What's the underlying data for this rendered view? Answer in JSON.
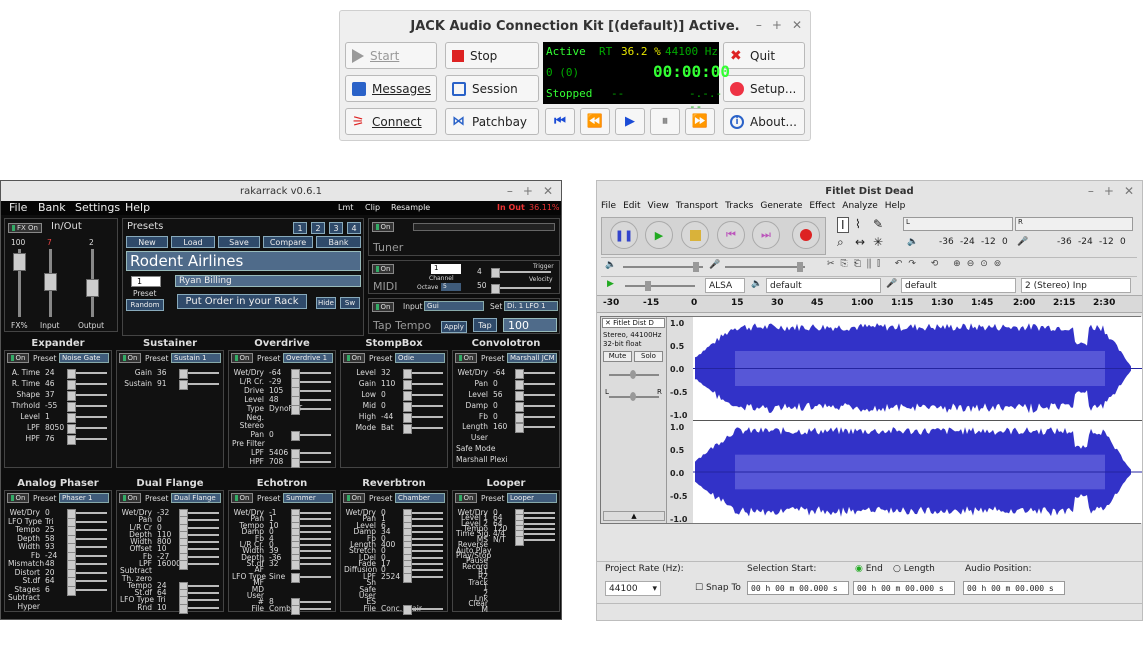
{
  "jack": {
    "title": "JACK Audio Connection Kit [(default)] Active.",
    "buttons": {
      "start": "Start",
      "stop": "Stop",
      "quit": "Quit",
      "messages": "Messages",
      "session": "Session",
      "setup": "Setup...",
      "connect": "Connect",
      "patchbay": "Patchbay",
      "about": "About..."
    },
    "display": {
      "state": "Active",
      "rt_label": "RT",
      "dsp": "36.2 %",
      "rate": "44100 Hz",
      "xruns": "0 (0)",
      "time": "00:00:00",
      "transport": "Stopped",
      "bpm": "--",
      "bbt": "-.-.---"
    },
    "colors": {
      "active": "#33ff33",
      "yellow": "#e8e800",
      "dim": "#00aa00"
    }
  },
  "rakarrack": {
    "title": "rakarrack  v0.6.1",
    "menu": [
      "File",
      "Bank",
      "Settings",
      "Help"
    ],
    "status": {
      "lmt": "Lmt",
      "clip": "Clip",
      "resample": "Resample",
      "inout": "In Out",
      "percent": "36.11%"
    },
    "fx_on": "FX On",
    "inout_label": "In/Out",
    "vals": [
      "100",
      "7",
      "2"
    ],
    "fader_labels": [
      "FX%",
      "Input",
      "Output"
    ],
    "presets_label": "Presets",
    "preset_nums": [
      "1",
      "2",
      "3",
      "4"
    ],
    "preset_buttons": [
      "New",
      "Load",
      "Save",
      "Compare",
      "Bank"
    ],
    "preset_name": "Rodent Airlines",
    "author": "Ryan Billing",
    "preset_num": "1",
    "preset_caption": "Preset",
    "random": "Random",
    "put_order": "Put Order in your Rack",
    "hide": "Hide",
    "sw": "Sw",
    "tuner": "Tuner",
    "midi": "MIDI",
    "channel": "Channel",
    "channel_val": "1",
    "octave": "Octave",
    "octave_val": "5",
    "trigger": "Trigger",
    "trigger_val": "4",
    "velocity": "Velocity",
    "velocity_val": "50",
    "input_label": "Input",
    "input_sel": "Gui",
    "set_label": "Set",
    "set_sel": "Di. 1 LFO 1",
    "tap_tempo": "Tap Tempo",
    "apply": "Apply",
    "tap": "Tap",
    "tap_val": "100",
    "on": "On",
    "preset": "Preset",
    "rows": [
      [
        {
          "name": "Expander",
          "preset": "Noise Gate",
          "params": [
            [
              "A. Time",
              "24"
            ],
            [
              "R. Time",
              "46"
            ],
            [
              "Shape",
              "37"
            ],
            [
              "Thrhold",
              "-55"
            ],
            [
              "Level",
              "1"
            ],
            [
              "LPF",
              "8050"
            ],
            [
              "HPF",
              "76"
            ]
          ]
        },
        {
          "name": "Sustainer",
          "preset": "Sustain 1",
          "params": [
            [
              "Gain",
              "36"
            ],
            [
              "Sustain",
              "91"
            ]
          ]
        },
        {
          "name": "Overdrive",
          "preset": "Overdrive 1",
          "params": [
            [
              "Wet/Dry",
              "-64"
            ],
            [
              "L/R Cr.",
              "-29"
            ],
            [
              "Drive",
              "105"
            ],
            [
              "Level",
              "48"
            ],
            [
              "Type",
              "DynoFET"
            ],
            [
              "Neg.",
              ""
            ],
            [
              "Stereo",
              ""
            ],
            [
              "Pan",
              "0"
            ],
            [
              "Pre Filter",
              ""
            ],
            [
              "LPF",
              "5406"
            ],
            [
              "HPF",
              "708"
            ]
          ]
        },
        {
          "name": "StompBox",
          "preset": "Odie",
          "params": [
            [
              "Level",
              "32"
            ],
            [
              "Gain",
              "110"
            ],
            [
              "Low",
              "0"
            ],
            [
              "Mid",
              "0"
            ],
            [
              "High",
              "-44"
            ],
            [
              "Mode",
              "Bat"
            ]
          ]
        },
        {
          "name": "Convolotron",
          "preset": "Marshall JCM",
          "params": [
            [
              "Wet/Dry",
              "-64"
            ],
            [
              "Pan",
              "0"
            ],
            [
              "Level",
              "56"
            ],
            [
              "Damp",
              "0"
            ],
            [
              "Fb",
              "0"
            ],
            [
              "Length",
              "160"
            ],
            [
              "User",
              ""
            ],
            [
              "Safe Mode",
              ""
            ],
            [
              "Marshall Plexi",
              ""
            ]
          ]
        }
      ],
      [
        {
          "name": "Analog Phaser",
          "preset": "Phaser 1",
          "params": [
            [
              "Wet/Dry",
              "0"
            ],
            [
              "LFO Type",
              "Tri"
            ],
            [
              "Tempo",
              "25"
            ],
            [
              "Depth",
              "58"
            ],
            [
              "Width",
              "93"
            ],
            [
              "Fb",
              "-24"
            ],
            [
              "Mismatch",
              "48"
            ],
            [
              "Distort",
              "20"
            ],
            [
              "St.df",
              "64"
            ],
            [
              "Stages",
              "6"
            ],
            [
              "Subtract",
              ""
            ],
            [
              "Hyper",
              ""
            ]
          ]
        },
        {
          "name": "Dual Flange",
          "preset": "Dual Flange",
          "params": [
            [
              "Wet/Dry",
              "-32"
            ],
            [
              "Pan",
              "0"
            ],
            [
              "L/R Cr",
              "0"
            ],
            [
              "Depth",
              "110"
            ],
            [
              "Width",
              "800"
            ],
            [
              "Offset",
              "10"
            ],
            [
              "Fb",
              "-27"
            ],
            [
              "LPF",
              "16000"
            ],
            [
              "Subtract",
              ""
            ],
            [
              "Th. zero",
              ""
            ],
            [
              "Tempo",
              "24"
            ],
            [
              "St.df",
              "64"
            ],
            [
              "LFO Type",
              "Tri"
            ],
            [
              "Rnd",
              "10"
            ]
          ]
        },
        {
          "name": "Echotron",
          "preset": "Summer",
          "params": [
            [
              "Wet/Dry",
              "-1"
            ],
            [
              "Pan",
              "1"
            ],
            [
              "Tempo",
              "10"
            ],
            [
              "Damp",
              "0"
            ],
            [
              "Fb",
              "4"
            ],
            [
              "L/R Cr.",
              "0"
            ],
            [
              "Width",
              "39"
            ],
            [
              "Depth",
              "-36"
            ],
            [
              "St.df",
              "32"
            ],
            [
              "AF",
              ""
            ],
            [
              "LFO Type",
              "Sine"
            ],
            [
              "MF",
              ""
            ],
            [
              "MD",
              ""
            ],
            [
              "User",
              ""
            ],
            [
              "#",
              "8"
            ],
            [
              "File",
              "Comb"
            ]
          ]
        },
        {
          "name": "Reverbtron",
          "preset": "Chamber",
          "params": [
            [
              "Wet/Dry",
              "0"
            ],
            [
              "Pan",
              "1"
            ],
            [
              "Level",
              "6"
            ],
            [
              "Damp",
              "34"
            ],
            [
              "Fb",
              "0"
            ],
            [
              "Length",
              "400"
            ],
            [
              "Stretch",
              "0"
            ],
            [
              "I.Del",
              "0"
            ],
            [
              "Fade",
              "17"
            ],
            [
              "Diffusion",
              "0"
            ],
            [
              "LPF",
              "2524"
            ],
            [
              "Sh",
              ""
            ],
            [
              "Safe",
              ""
            ],
            [
              "User",
              ""
            ],
            [
              "ES",
              ""
            ],
            [
              "File",
              "Conc. Stair"
            ]
          ]
        },
        {
          "name": "Looper",
          "preset": "Looper",
          "params": [
            [
              "Wet/Dry",
              "0"
            ],
            [
              "Level 1",
              "64"
            ],
            [
              "Level 2",
              "64"
            ],
            [
              "Tempo",
              "120"
            ],
            [
              "Time Sig.",
              "4/4"
            ],
            [
              "MS",
              "N/T"
            ],
            [
              "Reverse",
              ""
            ],
            [
              "Auto Play",
              ""
            ],
            [
              "Play/Stop",
              ""
            ],
            [
              "Pause",
              ""
            ],
            [
              "Record",
              ""
            ],
            [
              "R1",
              ""
            ],
            [
              "R2",
              ""
            ],
            [
              "Track",
              ""
            ],
            [
              "1",
              ""
            ],
            [
              "2",
              ""
            ],
            [
              "Lnk",
              ""
            ],
            [
              "Clear",
              ""
            ],
            [
              "M",
              ""
            ]
          ]
        }
      ]
    ]
  },
  "audacity": {
    "title": "Fitlet Dist Dead",
    "menu": [
      "File",
      "Edit",
      "View",
      "Transport",
      "Tracks",
      "Generate",
      "Effect",
      "Analyze",
      "Help"
    ],
    "meter_ticks": [
      "-36",
      "-24",
      "-12",
      "0"
    ],
    "lr": [
      "L",
      "R"
    ],
    "host": "ALSA",
    "output_device": "default",
    "input_device": "default",
    "channels": "2 (Stereo) Inp",
    "timeline": [
      "-30",
      "-15",
      "0",
      "15",
      "30",
      "45",
      "1:00",
      "1:15",
      "1:30",
      "1:45",
      "2:00",
      "2:15",
      "2:30"
    ],
    "track": {
      "name": "Fitlet Dist D",
      "info1": "Stereo, 44100Hz",
      "info2": "32-bit float",
      "mute": "Mute",
      "solo": "Solo",
      "gain_lbl": "L",
      "pan_l": "L",
      "pan_r": "R"
    },
    "scale": [
      "1.0",
      "0.5",
      "0.0",
      "-0.5",
      "-1.0"
    ],
    "project_rate_label": "Project Rate (Hz):",
    "project_rate": "44100",
    "selection_start": "Selection Start:",
    "end": "End",
    "length": "Length",
    "audio_position": "Audio Position:",
    "snap_to": "Snap To",
    "time_val": "00 h 00 m 00.000 s",
    "colors": {
      "wave": "#3232c8",
      "wave_light": "#6464dc"
    }
  }
}
